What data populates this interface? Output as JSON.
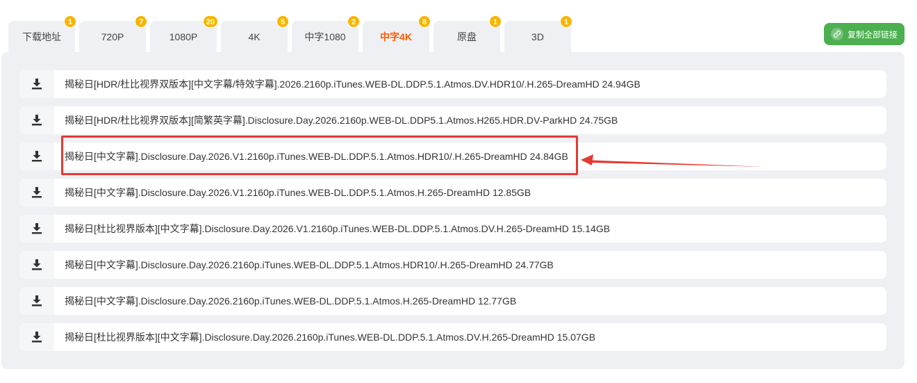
{
  "tabs": [
    {
      "label": "下载地址",
      "badge": "1"
    },
    {
      "label": "720P",
      "badge": "7"
    },
    {
      "label": "1080P",
      "badge": "20"
    },
    {
      "label": "4K",
      "badge": "5"
    },
    {
      "label": "中字1080",
      "badge": "2"
    },
    {
      "label": "中字4K",
      "badge": "8",
      "active": true
    },
    {
      "label": "原盘",
      "badge": "1"
    },
    {
      "label": "3D",
      "badge": "1"
    }
  ],
  "copy_all_label": "复制全部链接",
  "files": [
    {
      "name": "揭秘日[HDR/杜比视界双版本][中文字幕/特效字幕].2026.2160p.iTunes.WEB-DL.DDP.5.1.Atmos.DV.HDR10/.H.265-DreamHD 24.94GB"
    },
    {
      "name": "揭秘日[HDR/杜比视界双版本][简繁英字幕].Disclosure.Day.2026.2160p.WEB-DL.DDP5.1.Atmos.H265.HDR.DV-ParkHD 24.75GB"
    },
    {
      "name": "揭秘日[中文字幕].Disclosure.Day.2026.V1.2160p.iTunes.WEB-DL.DDP.5.1.Atmos.HDR10/.H.265-DreamHD 24.84GB"
    },
    {
      "name": "揭秘日[中文字幕].Disclosure.Day.2026.V1.2160p.iTunes.WEB-DL.DDP.5.1.Atmos.H.265-DreamHD 12.85GB"
    },
    {
      "name": "揭秘日[杜比视界版本][中文字幕].Disclosure.Day.2026.V1.2160p.iTunes.WEB-DL.DDP.5.1.Atmos.DV.H.265-DreamHD 15.14GB"
    },
    {
      "name": "揭秘日[中文字幕].Disclosure.Day.2026.2160p.iTunes.WEB-DL.DDP.5.1.Atmos.HDR10/.H.265-DreamHD 24.77GB"
    },
    {
      "name": "揭秘日[中文字幕].Disclosure.Day.2026.2160p.iTunes.WEB-DL.DDP.5.1.Atmos.H.265-DreamHD 12.77GB"
    },
    {
      "name": "揭秘日[杜比视界版本][中文字幕].Disclosure.Day.2026.2160p.iTunes.WEB-DL.DDP.5.1.Atmos.DV.H.265-DreamHD 15.07GB"
    }
  ],
  "colors": {
    "active_tab": "#ff5a00",
    "badge": "#f7b500",
    "copy_button": "#4caf50",
    "annotation": "#e53935"
  },
  "annotation": {
    "target_row": 3,
    "icon": "red-arrow"
  }
}
